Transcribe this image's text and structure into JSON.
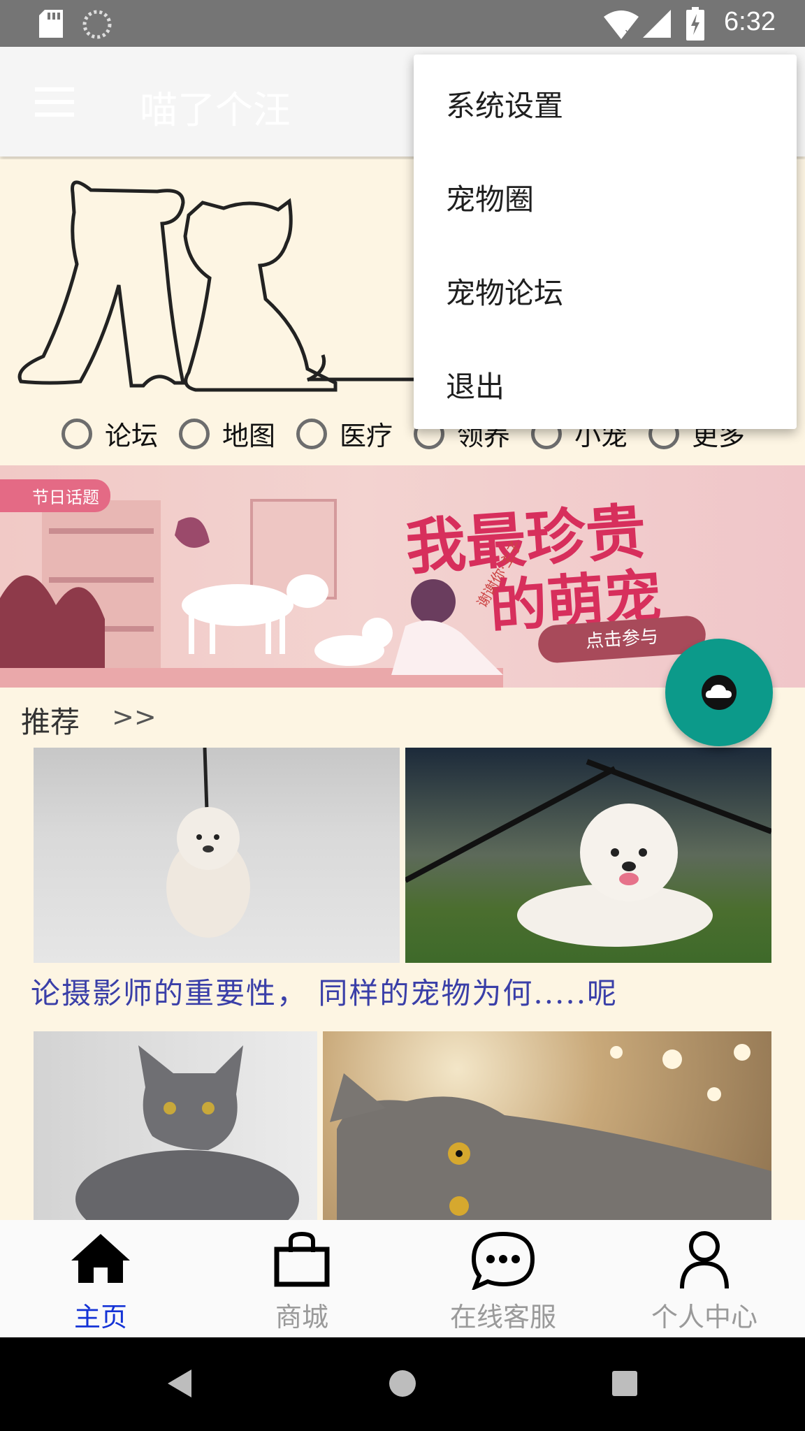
{
  "status_bar": {
    "time": "6:32"
  },
  "app_bar": {
    "title": "喵了个汪"
  },
  "overflow_menu": {
    "items": [
      "系统设置",
      "宠物圈",
      "宠物论坛",
      "退出"
    ]
  },
  "category_radios": [
    "论坛",
    "地图",
    "医疗",
    "领养",
    "小宠",
    "更多"
  ],
  "banner": {
    "tag": "节日话题",
    "headline_line1": "我最珍贵",
    "headline_line2": "的萌宠",
    "side_text": "谢谢你·主子",
    "cta": "点击参与"
  },
  "recommend": {
    "title": "推荐",
    "more": ">>",
    "caption": "论摄影师的重要性， 同样的宠物为何.....呢"
  },
  "bottom_nav": {
    "items": [
      {
        "label": "主页",
        "icon": "home-icon",
        "active": true
      },
      {
        "label": "商城",
        "icon": "shopping-bag-icon",
        "active": false
      },
      {
        "label": "在线客服",
        "icon": "chat-icon",
        "active": false
      },
      {
        "label": "个人中心",
        "icon": "person-icon",
        "active": false
      }
    ]
  },
  "colors": {
    "active_nav": "#1433d6",
    "fab": "#0c9a8a",
    "banner_text": "#d72f5c",
    "page_bg": "#fdf5e3"
  }
}
